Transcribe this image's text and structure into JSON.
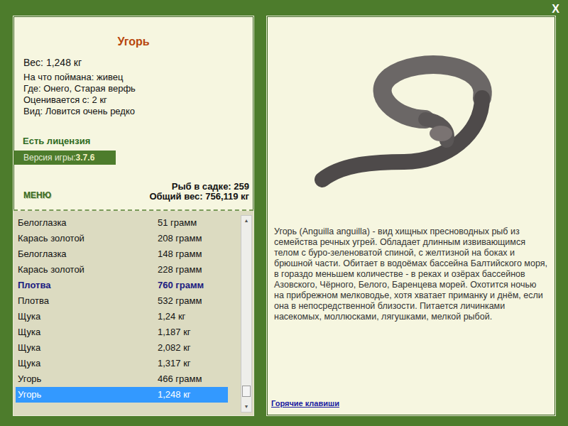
{
  "window": {
    "close_button": "X"
  },
  "fish_card": {
    "title": "Угорь",
    "weight": "Вес: 1,248 кг",
    "details": [
      "На что поймана: живец",
      "Где: Онего, Старая верфь",
      "Оценивается с: 2 кг",
      "Вид: Ловится очень редко"
    ],
    "license": "Есть лицензия",
    "version_label": "Версия игры: ",
    "version_value": "3.7.6"
  },
  "menu_button": "МЕНЮ",
  "totals": {
    "fish_count": "Рыб в садке: 259",
    "total_weight": "Общий вес: 756,119 кг"
  },
  "catch_list": [
    {
      "name": "Белоглазка",
      "weight": "51 грамм",
      "highlighted": false,
      "selected": false
    },
    {
      "name": "Карась золотой",
      "weight": "208 грамм",
      "highlighted": false,
      "selected": false
    },
    {
      "name": "Белоглазка",
      "weight": "148 грамм",
      "highlighted": false,
      "selected": false
    },
    {
      "name": "Карась золотой",
      "weight": "228 грамм",
      "highlighted": false,
      "selected": false
    },
    {
      "name": "Плотва",
      "weight": "760 грамм",
      "highlighted": true,
      "selected": false
    },
    {
      "name": "Плотва",
      "weight": "532 грамм",
      "highlighted": false,
      "selected": false
    },
    {
      "name": "Щука",
      "weight": "1,24 кг",
      "highlighted": false,
      "selected": false
    },
    {
      "name": "Щука",
      "weight": "1,187 кг",
      "highlighted": false,
      "selected": false
    },
    {
      "name": "Щука",
      "weight": "2,082 кг",
      "highlighted": false,
      "selected": false
    },
    {
      "name": "Щука",
      "weight": "1,317 кг",
      "highlighted": false,
      "selected": false
    },
    {
      "name": "Угорь",
      "weight": "466 грамм",
      "highlighted": false,
      "selected": false
    },
    {
      "name": "Угорь",
      "weight": "1,248 кг",
      "highlighted": false,
      "selected": true
    }
  ],
  "scrollbar": {
    "up": "▲",
    "down": "▼",
    "level": 0.97
  },
  "description": "Угорь (Anguilla anguilla) - вид хищных пресноводных рыб из семейства речных угрей. Обладает длинным извивающимся телом с буро-зеленоватой спиной, с желтизной на боках и брюшной части. Обитает в водоёмах бассейна Балтийского моря, в гораздо меньшем количестве - в реках и озёрах бассейнов Азовского, Чёрного, Белого, Баренцева морей. Охотится ночью на прибрежном мелководье, хотя хватает приманку и днём, если она в непосредственной близости. Питается личинками насекомых, моллюсками, лягушками, мелкой рыбой.",
  "hotkeys_link": "Горячие клавиши"
}
